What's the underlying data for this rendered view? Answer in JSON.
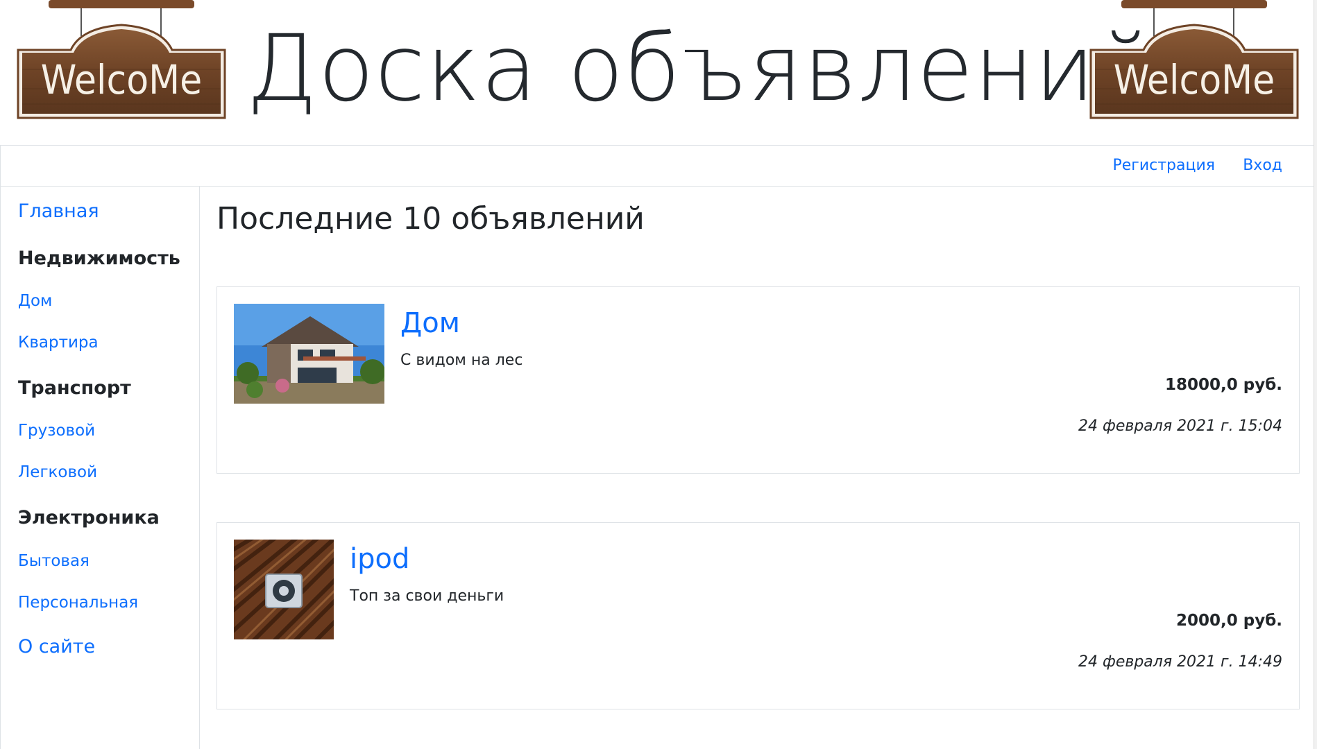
{
  "header": {
    "title": "Доска объявлений",
    "sign_left_text": "WelcoMe",
    "sign_right_text": "WelcoMe"
  },
  "topnav": {
    "register": "Регистрация",
    "login": "Вход"
  },
  "sidebar": {
    "home": "Главная",
    "sections": [
      {
        "title": "Недвижимость",
        "items": [
          "Дом",
          "Квартира"
        ]
      },
      {
        "title": "Транспорт",
        "items": [
          "Грузовой",
          "Легковой"
        ]
      },
      {
        "title": "Электроника",
        "items": [
          "Бытовая",
          "Персональная"
        ]
      }
    ],
    "about": "О сайте"
  },
  "main": {
    "heading": "Последние 10 объявлений",
    "listings": [
      {
        "title": "Дом",
        "description": "С видом на лес",
        "price": "18000,0 руб.",
        "date": "24 февраля 2021 г. 15:04",
        "image_icon": "house-photo"
      },
      {
        "title": "ipod",
        "description": "Топ за свои деньги",
        "price": "2000,0 руб.",
        "date": "24 февраля 2021 г. 14:49",
        "image_icon": "ipod-photo"
      }
    ]
  },
  "colors": {
    "link": "#0d6efd",
    "text": "#212529",
    "border": "#dee2e6",
    "wood": "#7a4a2a"
  }
}
